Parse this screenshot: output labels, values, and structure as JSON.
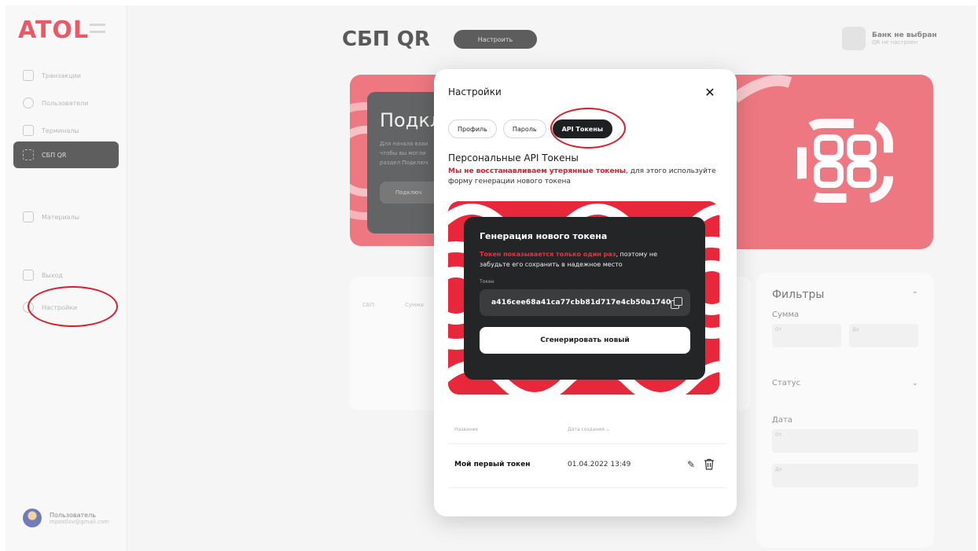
{
  "sidebar": {
    "logo": "ATOL",
    "items": [
      {
        "label": "Транзакции",
        "icon": "transactions-icon"
      },
      {
        "label": "Пользователи",
        "icon": "users-icon"
      },
      {
        "label": "Терминалы",
        "icon": "terminals-icon"
      },
      {
        "label": "СБП QR",
        "icon": "qr-icon",
        "active": true
      },
      {
        "label": "Материалы",
        "icon": "materials-icon"
      },
      {
        "label": "Выход",
        "icon": "exit-icon"
      },
      {
        "label": "Настройки",
        "icon": "settings-icon"
      }
    ],
    "user": {
      "name": "Пользователь",
      "email": "mpostlov@gmail.com"
    }
  },
  "header": {
    "title": "СБП QR",
    "configure_label": "Настроить",
    "bank_title": "Банк не выбран",
    "bank_subtitle": "QR не настроен"
  },
  "background": {
    "connect_heading": "Подкл",
    "connect_text": "Для начала взаи чтобы вы могли раздел Подключ",
    "connect_button": "Подключ",
    "table_headers": [
      "СБП",
      "Сумма"
    ],
    "filters": {
      "title": "Фильтры",
      "amount_label": "Сумма",
      "from": "От",
      "to": "До",
      "status_label": "Статус",
      "date_label": "Дата"
    }
  },
  "modal": {
    "title": "Настройки",
    "tabs": [
      {
        "label": "Профиль",
        "active": false
      },
      {
        "label": "Пароль",
        "active": false
      },
      {
        "label": "API Токены",
        "active": true
      }
    ],
    "section_title": "Персональные API Токены",
    "warning_red": "Мы не восстанавливаем утерянные токены",
    "warning_rest": ", для этого используйте форму генерации нового токена",
    "generation": {
      "title": "Генерация нового токена",
      "note_red": "Токен показывается только один раз",
      "note_rest": ", поэтому не забудьте его сохранить в надежное место",
      "token_label": "Токен",
      "token_value": "a416cee68a41ca77cbb81d717e4cb50a174089...",
      "generate_label": "Сгенерировать новый"
    },
    "list": {
      "col_name": "Название",
      "col_date": "Дата создания",
      "rows": [
        {
          "name": "Мой первый токен",
          "date": "01.04.2022 13:49"
        }
      ]
    }
  },
  "colors": {
    "accent": "#e11b2c",
    "dark": "#232526"
  }
}
